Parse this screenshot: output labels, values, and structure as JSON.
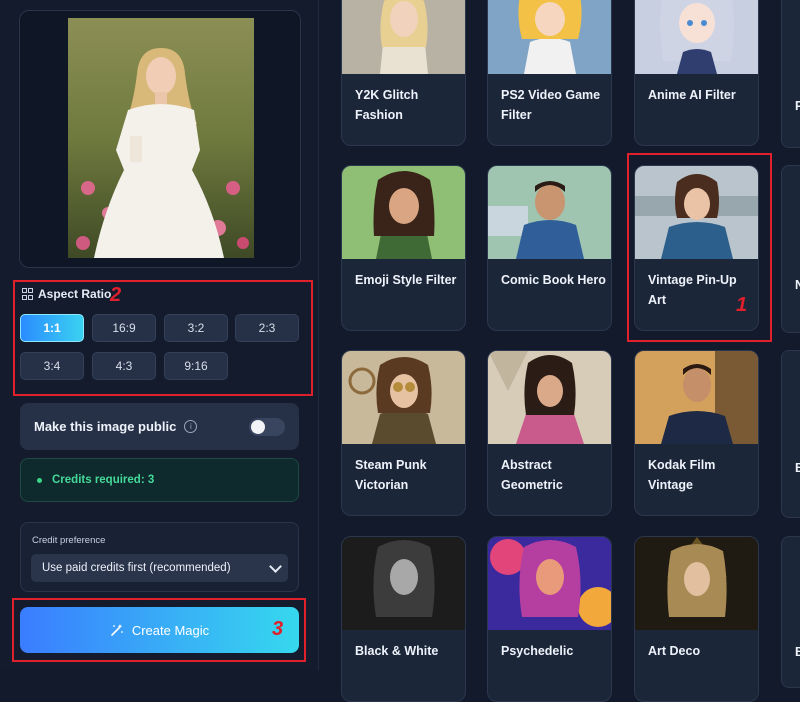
{
  "aspect": {
    "title": "Aspect Ratio",
    "options": [
      "1:1",
      "16:9",
      "3:2",
      "2:3",
      "3:4",
      "4:3",
      "9:16"
    ],
    "selected": "1:1"
  },
  "public_toggle": {
    "label": "Make this image public",
    "info_glyph": "i",
    "enabled": false
  },
  "credits": {
    "text": "Credits required: 3"
  },
  "credit_preference": {
    "label": "Credit preference",
    "value": "Use paid credits first (recommended)"
  },
  "create_button": {
    "label": "Create Magic"
  },
  "annotations": [
    "1",
    "2",
    "3"
  ],
  "gallery": {
    "cards": [
      {
        "title": "Y2K Glitch Fashion"
      },
      {
        "title": "PS2 Video Game Filter"
      },
      {
        "title": "Anime AI Filter"
      },
      {
        "title": "Emoji Style Filter"
      },
      {
        "title": "Comic Book Hero"
      },
      {
        "title": "Vintage Pin-Up Art"
      },
      {
        "title": "Steam Punk Victorian"
      },
      {
        "title": "Abstract Geometric"
      },
      {
        "title": "Kodak Film Vintage"
      },
      {
        "title": "Black & White"
      },
      {
        "title": "Psychedelic"
      },
      {
        "title": "Art Deco"
      }
    ],
    "partial_letters": [
      "P",
      "N",
      "B",
      "B"
    ]
  },
  "colors": {
    "accent_start": "#2a8cff",
    "accent_end": "#36d8ee",
    "annotation_red": "#e0202b",
    "credits_green": "#44d99a"
  }
}
